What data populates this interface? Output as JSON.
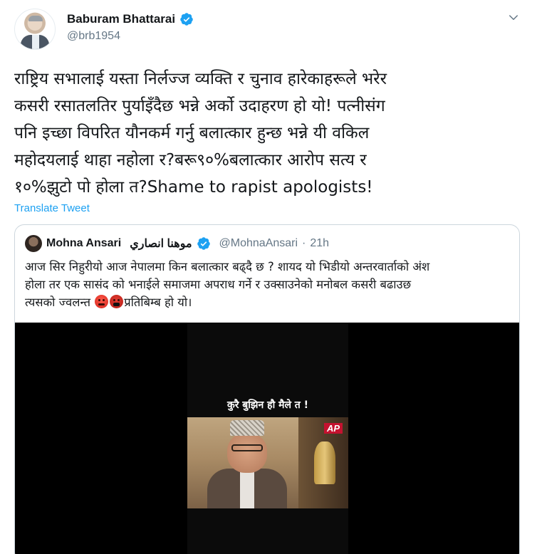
{
  "tweet": {
    "author": {
      "display_name": "Baburam Bhattarai",
      "handle": "@brb1954",
      "verified": true
    },
    "text": "राष्ट्रिय सभालाई यस्ता निर्लज्ज व्यक्ति र चुनाव हारेकाहरूले भरेर\nकसरी रसातलतिर पुर्याइँदैछ भन्ने अर्को उदाहरण हो यो! पत्नीसंग\nपनि इच्छा विपरित यौनकर्म गर्नु बलात्कार हुन्छ भन्ने यी वकिल\nमहोदयलाई थाहा नहोला र?बरू९०%बलात्कार आरोप सत्य र\n१०%झुटो पो होला त?Shame to rapist apologists!",
    "translate_label": "Translate Tweet",
    "menu_icon": "chevron-down-icon"
  },
  "quoted": {
    "author": {
      "display_name": "Mohna Ansari",
      "display_name_arabic": "موهنا انصاري",
      "handle": "@MohnaAnsari",
      "separator": "·",
      "time": "21h",
      "verified": true
    },
    "text_part1": "आज सिर निहुरीयो आज नेपालमा किन बलात्कार बढ्दै छ ? शायद यो भिडीयो अन्तरवार्ताको अंश\nहोला तर एक सासंद को भनाईले समाजमा अपराध गर्ने र उक्साउनेको मनोबल कसरी बढाउछ\nत्यसको ज्वलन्त ",
    "text_part2": "प्रतिबिम्ब हो यो।",
    "emojis": [
      "angry-face-icon",
      "face-with-symbols-on-mouth-icon"
    ],
    "video": {
      "caption": "कुरै बुझिन हौ मैले त !",
      "channel_logo": "AP"
    }
  },
  "colors": {
    "accent": "#1da1f2",
    "text": "#14171a",
    "secondary": "#657786",
    "border": "#ccd6dd"
  }
}
